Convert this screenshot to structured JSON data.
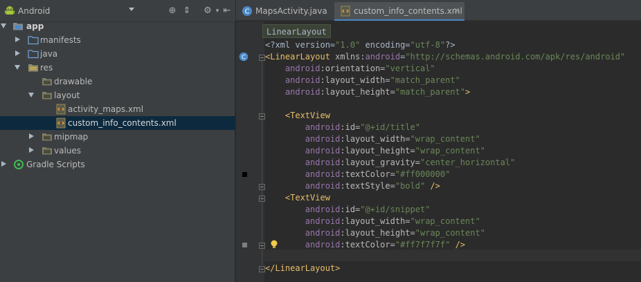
{
  "project": {
    "view": "Android",
    "tree": [
      {
        "label": "app",
        "bold": true
      },
      {
        "label": "manifests"
      },
      {
        "label": "java"
      },
      {
        "label": "res"
      },
      {
        "label": "drawable"
      },
      {
        "label": "layout"
      },
      {
        "label": "activity_maps.xml"
      },
      {
        "label": "custom_info_contents.xml"
      },
      {
        "label": "mipmap"
      },
      {
        "label": "values"
      },
      {
        "label": "Gradle Scripts"
      }
    ]
  },
  "tabs": [
    {
      "label": "MapsActivity.java"
    },
    {
      "label": "custom_info_contents.xml"
    }
  ],
  "editor": {
    "breadcrumb": "LinearLayout",
    "lines": [
      [
        {
          "c": "t-plain",
          "t": "<?xml version="
        },
        {
          "c": "t-val",
          "t": "\"1.0\""
        },
        {
          "c": "t-plain",
          "t": " encoding="
        },
        {
          "c": "t-val",
          "t": "\"utf-8\""
        },
        {
          "c": "t-plain",
          "t": "?>"
        }
      ],
      [
        {
          "c": "t-tag",
          "t": "<LinearLayout "
        },
        {
          "c": "t-attr",
          "t": "xmlns:"
        },
        {
          "c": "t-ns",
          "t": "android"
        },
        {
          "c": "t-plain",
          "t": "="
        },
        {
          "c": "t-val",
          "t": "\"http://schemas.android.com/apk/res/android\""
        }
      ],
      [
        {
          "c": "t-plain",
          "t": "    "
        },
        {
          "c": "t-ns",
          "t": "android"
        },
        {
          "c": "t-attr",
          "t": ":orientation="
        },
        {
          "c": "t-val",
          "t": "\"vertical\""
        }
      ],
      [
        {
          "c": "t-plain",
          "t": "    "
        },
        {
          "c": "t-ns",
          "t": "android"
        },
        {
          "c": "t-attr",
          "t": ":layout_width="
        },
        {
          "c": "t-val",
          "t": "\"match_parent\""
        }
      ],
      [
        {
          "c": "t-plain",
          "t": "    "
        },
        {
          "c": "t-ns",
          "t": "android"
        },
        {
          "c": "t-attr",
          "t": ":layout_height="
        },
        {
          "c": "t-val",
          "t": "\"match_parent\""
        },
        {
          "c": "t-tag",
          "t": ">"
        }
      ],
      [],
      [
        {
          "c": "t-plain",
          "t": "    "
        },
        {
          "c": "t-tag",
          "t": "<TextView"
        }
      ],
      [
        {
          "c": "t-plain",
          "t": "        "
        },
        {
          "c": "t-ns",
          "t": "android"
        },
        {
          "c": "t-attr",
          "t": ":id="
        },
        {
          "c": "t-val",
          "t": "\"@+id/title\""
        }
      ],
      [
        {
          "c": "t-plain",
          "t": "        "
        },
        {
          "c": "t-ns",
          "t": "android"
        },
        {
          "c": "t-attr",
          "t": ":layout_width="
        },
        {
          "c": "t-val",
          "t": "\"wrap_content\""
        }
      ],
      [
        {
          "c": "t-plain",
          "t": "        "
        },
        {
          "c": "t-ns",
          "t": "android"
        },
        {
          "c": "t-attr",
          "t": ":layout_height="
        },
        {
          "c": "t-val",
          "t": "\"wrap_content\""
        }
      ],
      [
        {
          "c": "t-plain",
          "t": "        "
        },
        {
          "c": "t-ns",
          "t": "android"
        },
        {
          "c": "t-attr",
          "t": ":layout_gravity="
        },
        {
          "c": "t-val",
          "t": "\"center_horizontal\""
        }
      ],
      [
        {
          "c": "t-plain",
          "t": "        "
        },
        {
          "c": "t-ns",
          "t": "android"
        },
        {
          "c": "t-attr",
          "t": ":textColor="
        },
        {
          "c": "t-val",
          "t": "\"#ff000000\""
        }
      ],
      [
        {
          "c": "t-plain",
          "t": "        "
        },
        {
          "c": "t-ns",
          "t": "android"
        },
        {
          "c": "t-attr",
          "t": ":textStyle="
        },
        {
          "c": "t-val",
          "t": "\"bold\""
        },
        {
          "c": "t-tag",
          "t": " />"
        }
      ],
      [
        {
          "c": "t-plain",
          "t": "    "
        },
        {
          "c": "t-tag",
          "t": "<TextView"
        }
      ],
      [
        {
          "c": "t-plain",
          "t": "        "
        },
        {
          "c": "t-ns",
          "t": "android"
        },
        {
          "c": "t-attr",
          "t": ":id="
        },
        {
          "c": "t-val",
          "t": "\"@+id/snippet\""
        }
      ],
      [
        {
          "c": "t-plain",
          "t": "        "
        },
        {
          "c": "t-ns",
          "t": "android"
        },
        {
          "c": "t-attr",
          "t": ":layout_width="
        },
        {
          "c": "t-val",
          "t": "\"wrap_content\""
        }
      ],
      [
        {
          "c": "t-plain",
          "t": "        "
        },
        {
          "c": "t-ns",
          "t": "android"
        },
        {
          "c": "t-attr",
          "t": ":layout_height="
        },
        {
          "c": "t-val",
          "t": "\"wrap_content\""
        }
      ],
      [
        {
          "c": "t-plain",
          "t": "        "
        },
        {
          "c": "t-ns",
          "t": "android"
        },
        {
          "c": "t-attr",
          "t": ":textColor="
        },
        {
          "c": "t-val",
          "t": "\"#ff7f7f7f\""
        },
        {
          "c": "t-tag",
          "t": " />"
        }
      ],
      [],
      [
        {
          "c": "t-tag",
          "t": "</LinearLayout>"
        }
      ]
    ]
  },
  "colors": {
    "panel_bg": "#3c3f41",
    "editor_bg": "#2b2b2b",
    "selection": "#0d293e",
    "tag": "#e8bf6a",
    "value": "#6a8759",
    "namespace": "#9876aa",
    "accent": "#4a88c7"
  }
}
